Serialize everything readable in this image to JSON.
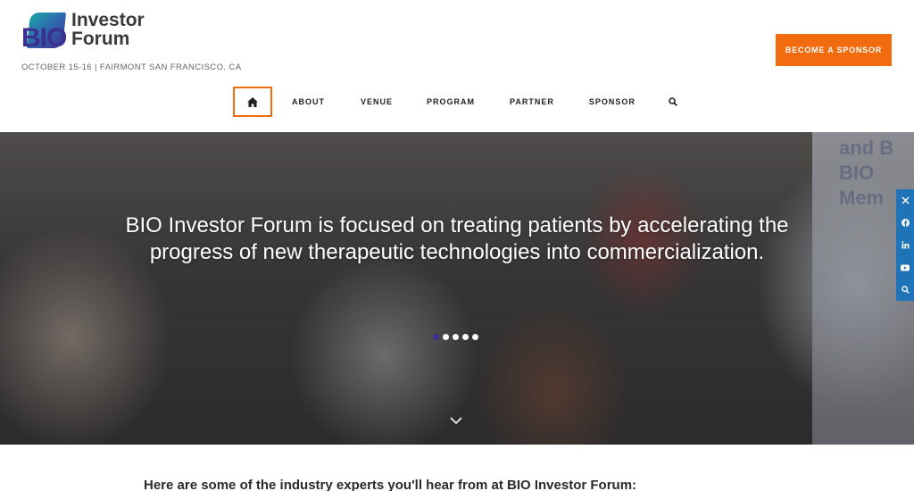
{
  "header": {
    "logo_bio": "BIO",
    "logo_line1": "Investor",
    "logo_line2": "Forum",
    "tagline": "OCTOBER 15-16 | FAIRMONT SAN FRANCISCO, CA",
    "sponsor_button": "BECOME A SPONSOR"
  },
  "nav": {
    "home_icon": "home-icon",
    "items": [
      {
        "label": "ABOUT"
      },
      {
        "label": "VENUE"
      },
      {
        "label": "PROGRAM"
      },
      {
        "label": "PARTNER"
      },
      {
        "label": "SPONSOR"
      }
    ],
    "search_icon": "search-icon"
  },
  "hero": {
    "text": "BIO Investor Forum is focused on treating patients by accelerating the progress of new therapeutic technologies into commercialization.",
    "slides_total": 5,
    "active_slide": 1
  },
  "social": {
    "icons": [
      "x-icon",
      "facebook-icon",
      "linkedin-icon",
      "youtube-icon",
      "search-icon"
    ]
  },
  "section": {
    "experts_heading": "Here are some of the industry experts you'll hear from at BIO Investor Forum:"
  },
  "colors": {
    "accent": "#f26b0f",
    "brand_purple": "#3b2f8f",
    "social_blue": "#1f73b7"
  }
}
